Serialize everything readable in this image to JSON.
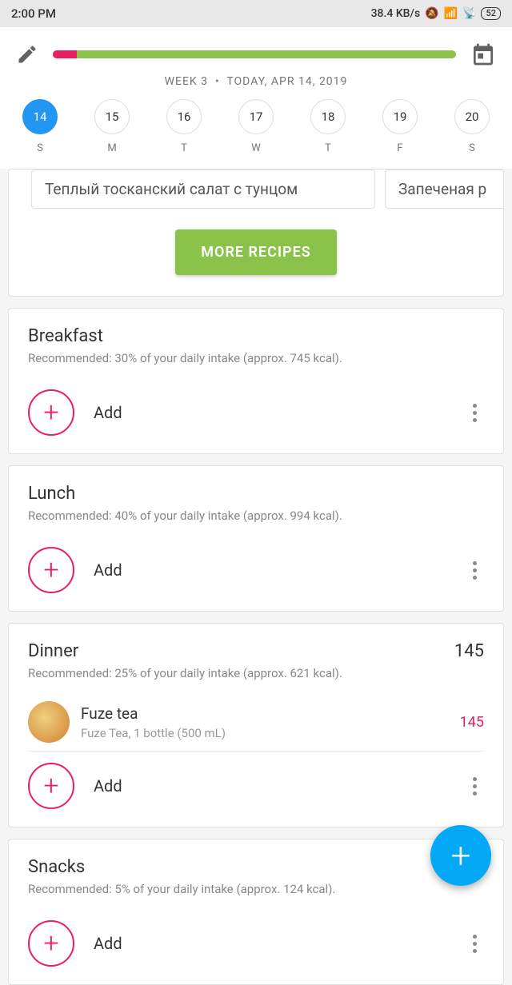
{
  "status": {
    "time": "2:00 PM",
    "speed": "38.4 KB/s",
    "battery": "52"
  },
  "header": {
    "week": "WEEK 3",
    "date": "TODAY, APR 14, 2019"
  },
  "days": [
    {
      "num": "14",
      "letter": "S",
      "active": true
    },
    {
      "num": "15",
      "letter": "M",
      "active": false
    },
    {
      "num": "16",
      "letter": "T",
      "active": false
    },
    {
      "num": "17",
      "letter": "W",
      "active": false
    },
    {
      "num": "18",
      "letter": "T",
      "active": false
    },
    {
      "num": "19",
      "letter": "F",
      "active": false
    },
    {
      "num": "20",
      "letter": "S",
      "active": false
    }
  ],
  "recipes": {
    "cards": [
      "Теплый тосканский салат с тунцом",
      "Запеченая р"
    ],
    "more_label": "MORE RECIPES"
  },
  "meals": [
    {
      "title": "Breakfast",
      "rec": "Recommended: 30% of your daily intake (approx. 745 kcal).",
      "kcal": "",
      "items": [],
      "add_label": "Add"
    },
    {
      "title": "Lunch",
      "rec": "Recommended: 40% of your daily intake (approx. 994 kcal).",
      "kcal": "",
      "items": [],
      "add_label": "Add"
    },
    {
      "title": "Dinner",
      "rec": "Recommended: 25% of your daily intake (approx. 621 kcal).",
      "kcal": "145",
      "items": [
        {
          "name": "Fuze tea",
          "detail": "Fuze Tea, 1 bottle (500 mL)",
          "kcal": "145"
        }
      ],
      "add_label": "Add"
    },
    {
      "title": "Snacks",
      "rec": "Recommended: 5% of your daily intake (approx. 124 kcal).",
      "kcal": "",
      "items": [],
      "add_label": "Add"
    }
  ]
}
